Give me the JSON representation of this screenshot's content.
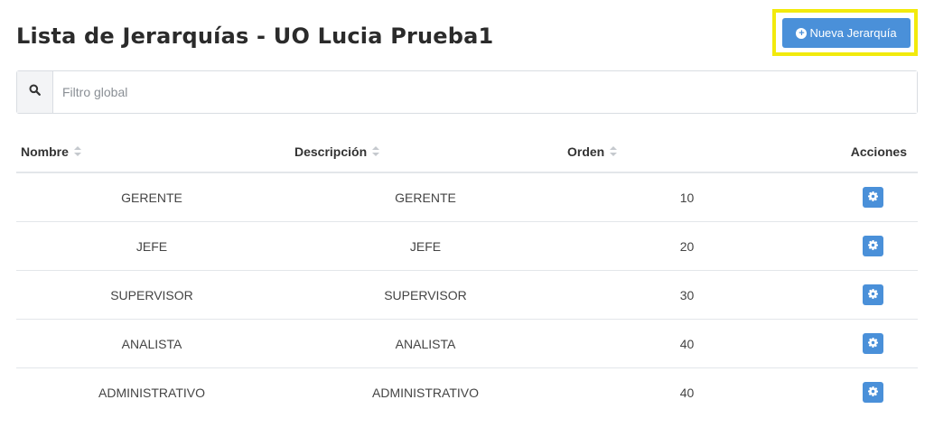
{
  "page": {
    "title": "Lista de Jerarquías - UO Lucia Prueba1"
  },
  "toolbar": {
    "new_button_label": "Nueva Jerarquía",
    "plus_icon": "+"
  },
  "search": {
    "placeholder": "Filtro global",
    "value": ""
  },
  "table": {
    "columns": {
      "nombre": "Nombre",
      "descripcion": "Descripción",
      "orden": "Orden",
      "acciones": "Acciones"
    },
    "rows": [
      {
        "nombre": "GERENTE",
        "descripcion": "GERENTE",
        "orden": "10"
      },
      {
        "nombre": "JEFE",
        "descripcion": "JEFE",
        "orden": "20"
      },
      {
        "nombre": "SUPERVISOR",
        "descripcion": "SUPERVISOR",
        "orden": "30"
      },
      {
        "nombre": "ANALISTA",
        "descripcion": "ANALISTA",
        "orden": "40"
      },
      {
        "nombre": "ADMINISTRATIVO",
        "descripcion": "ADMINISTRATIVO",
        "orden": "40"
      }
    ]
  },
  "icons": {
    "search": "search-icon",
    "sort": "sort-icon",
    "action": "gear-icon",
    "plus": "plus-circle-icon"
  },
  "colors": {
    "accent": "#4a90d9",
    "highlight": "#f2ea0c",
    "border": "#e3e6ea"
  }
}
